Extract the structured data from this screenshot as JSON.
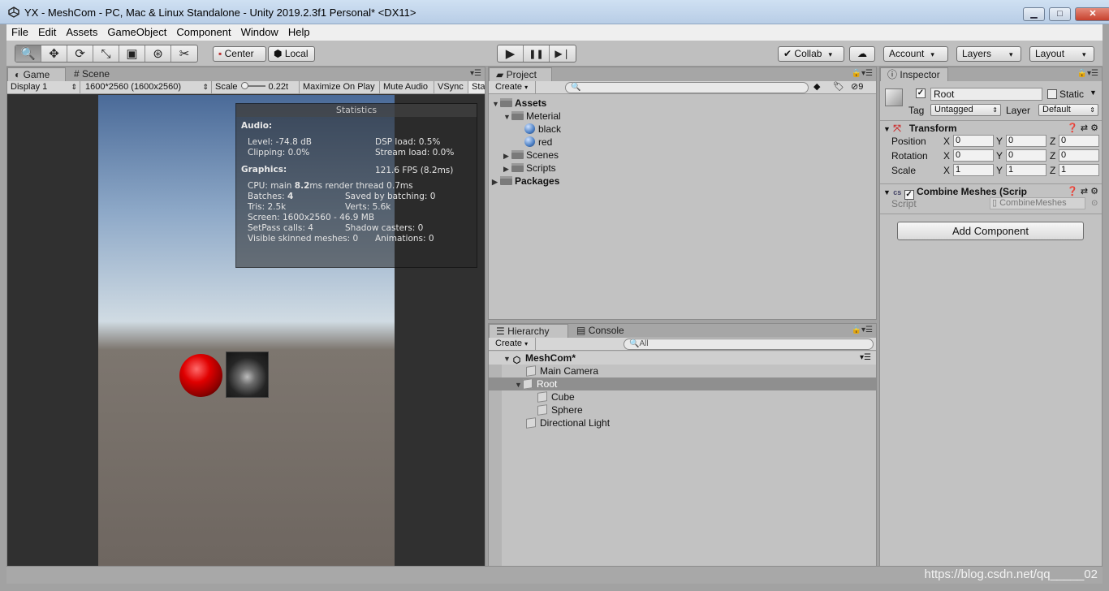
{
  "window": {
    "title": "YX - MeshCom - PC, Mac & Linux Standalone - Unity 2019.2.3f1 Personal* <DX11>",
    "min_glyph": "▁",
    "max_glyph": "□",
    "close_glyph": "✕"
  },
  "menu": [
    "File",
    "Edit",
    "Assets",
    "GameObject",
    "Component",
    "Window",
    "Help"
  ],
  "toolbar": {
    "tools": [
      "🔍",
      "✥",
      "⟳",
      "⤡",
      "▣",
      "⊛",
      "✂"
    ],
    "pivot": "Center",
    "space": "Local",
    "play": "▶",
    "pause": "❚❚",
    "step": "▶❘",
    "collab": "Collab",
    "cloud": "☁",
    "account": "Account",
    "layers": "Layers",
    "layout": "Layout",
    "dropdown_arrow": "▾"
  },
  "game": {
    "tab_game": "Game",
    "tab_scene": "Scene",
    "display": "Display 1",
    "resolution": "1600*2560 (1600x2560)",
    "scale_label": "Scale",
    "scale_value": "0.22t",
    "maximize": "Maximize On Play",
    "mute": "Mute Audio",
    "vsync": "VSync",
    "stats_toggle": "Sta"
  },
  "stats": {
    "title": "Statistics",
    "audio_header": "Audio:",
    "level": "Level: -74.8 dB",
    "dsp": "DSP load: 0.5%",
    "clipping": "Clipping: 0.0%",
    "stream": "Stream load: 0.0%",
    "graphics_header": "Graphics:",
    "fps": "121.6 FPS (8.2ms)",
    "cpu_pre": "CPU: main ",
    "cpu_main": "8.2",
    "cpu_post": "ms  render thread 0.7ms",
    "batches_pre": "Batches: ",
    "batches": "4",
    "saved": "Saved by batching: 0",
    "tris": "Tris: 2.5k",
    "verts": "Verts: 5.6k",
    "screen": "Screen: 1600x2560 - 46.9 MB",
    "setpass": "SetPass calls: 4",
    "shadow": "Shadow casters: 0",
    "skinned": "Visible skinned meshes: 0",
    "animations": "Animations: 0"
  },
  "project": {
    "tab": "Project",
    "create": "Create",
    "filter_count": "9",
    "assets": "Assets",
    "meterial": "Meterial",
    "black": "black",
    "red": "red",
    "scenes": "Scenes",
    "scripts": "Scripts",
    "packages": "Packages"
  },
  "hierarchy": {
    "tab": "Hierarchy",
    "console_tab": "Console",
    "create": "Create",
    "search_placeholder": "All",
    "scene": "MeshCom*",
    "items": [
      "Main Camera",
      "Root",
      "Cube",
      "Sphere",
      "Directional Light"
    ]
  },
  "inspector": {
    "tab": "Inspector",
    "name": "Root",
    "static": "Static",
    "tag_label": "Tag",
    "tag": "Untagged",
    "layer_label": "Layer",
    "layer": "Default",
    "transform": "Transform",
    "position": "Position",
    "rotation": "Rotation",
    "scale": "Scale",
    "x": "X",
    "y": "Y",
    "z": "Z",
    "pos": [
      "0",
      "0",
      "0"
    ],
    "rot": [
      "0",
      "0",
      "0"
    ],
    "scl": [
      "1",
      "1",
      "1"
    ],
    "combine": "Combine Meshes (Scrip",
    "script_label": "Script",
    "script_value": "CombineMeshes",
    "add_component": "Add Component"
  },
  "status": {
    "watermark": "https://blog.csdn.net/qq_____02"
  }
}
